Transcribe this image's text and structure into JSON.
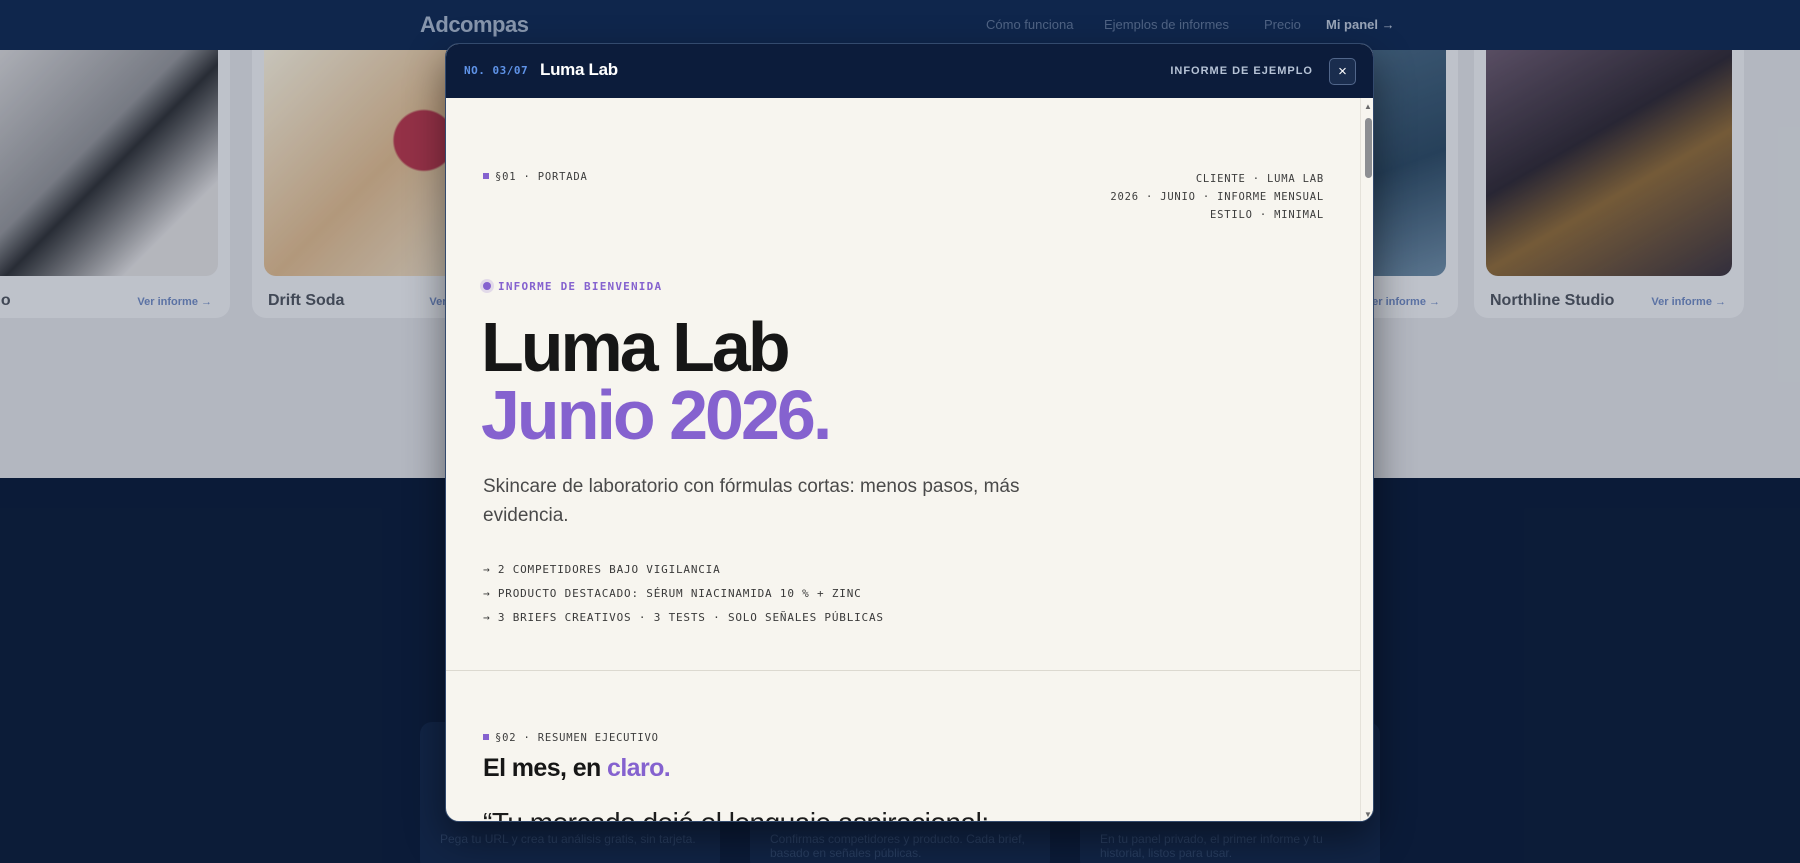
{
  "background": {
    "logo": "Adcompas",
    "nav": [
      "Cómo funciona",
      "Ejemplos de informes",
      "Precio"
    ],
    "nav_cta": "Mi panel →",
    "cards": [
      {
        "name": "Halo",
        "link": "Ver informe →",
        "color": "#55595f"
      },
      {
        "name": "Drift Soda",
        "link": "Ver informe →",
        "color": "#c9a98a"
      },
      {
        "name": "",
        "link": "Ver informe →",
        "color": "#3d5a73"
      },
      {
        "name": "Northline Studio",
        "link": "Ver informe →",
        "color": "#4a4552"
      }
    ],
    "panel_texts": [
      "Pega tu URL y crea tu análisis gratis, sin tarjeta.",
      "Confirmas competidores y producto. Cada brief, basado en señales públicas.",
      "En tu panel privado, el primer informe y tu historial, listos para usar."
    ]
  },
  "modal": {
    "number": "NO. 03/07",
    "title": "Luma Lab",
    "label": "INFORME DE EJEMPLO",
    "close": "×",
    "section1": {
      "label": "§01 · PORTADA",
      "meta": [
        "CLIENTE · LUMA LAB",
        "2026 · JUNIO · INFORME MENSUAL",
        "ESTILO · MINIMAL"
      ],
      "welcome": "INFORME DE BIENVENIDA",
      "hero_line1": "Luma Lab",
      "hero_line2": "Junio 2026.",
      "subtitle": "Skincare de laboratorio con fórmulas cortas: menos pasos, más evidencia.",
      "bullets": [
        "→ 2 COMPETIDORES BAJO VIGILANCIA",
        "→ PRODUCTO DESTACADO: SÉRUM NIACINAMIDA 10 % + ZINC",
        "→ 3 BRIEFS CREATIVOS · 3 TESTS · SOLO SEÑALES PÚBLICAS"
      ]
    },
    "section2": {
      "label": "§02 · RESUMEN EJECUTIVO",
      "title_main": "El mes, en",
      "title_accent": "claro.",
      "quote": "“Tu mercado dejó el lenguaje aspiracional: ahora compite en prueba."
    }
  },
  "colors": {
    "accent": "#8562cf",
    "header": "#0c1c3b",
    "paper": "#f7f5ef"
  }
}
